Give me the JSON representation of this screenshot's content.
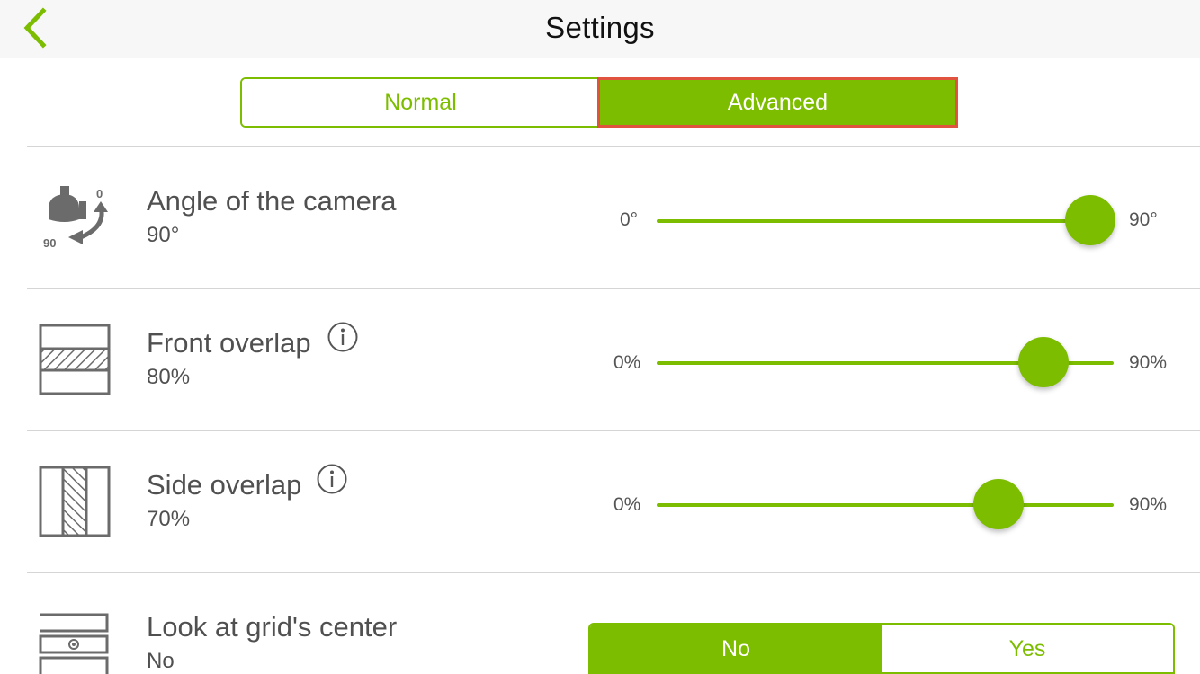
{
  "header": {
    "title": "Settings"
  },
  "mode_tabs": {
    "normal_label": "Normal",
    "advanced_label": "Advanced",
    "selected": "Advanced"
  },
  "settings": {
    "camera_angle": {
      "title": "Angle of the camera",
      "value": "90°",
      "min_label": "0°",
      "max_label": "90°",
      "position": 1.0,
      "icon_label_top": "0",
      "icon_label_bottom": "90"
    },
    "front_overlap": {
      "title": "Front overlap",
      "value": "80%",
      "min_label": "0%",
      "max_label": "90%",
      "position": 0.889
    },
    "side_overlap": {
      "title": "Side overlap",
      "value": "70%",
      "min_label": "0%",
      "max_label": "90%",
      "position": 0.778
    },
    "look_at_center": {
      "title": "Look at grid's center",
      "value": "No",
      "no_label": "No",
      "yes_label": "Yes",
      "selected": "No"
    }
  },
  "colors": {
    "accent": "#7dbd00",
    "highlight_border": "#e0533f",
    "icon_gray": "#6b6b6b"
  },
  "icons": {
    "back": "chevron-left-icon",
    "info": "info-circle-icon",
    "camera_angle": "camera-tilt-icon",
    "front_overlap": "front-overlap-icon",
    "side_overlap": "side-overlap-icon",
    "grid_center": "grid-center-icon"
  }
}
